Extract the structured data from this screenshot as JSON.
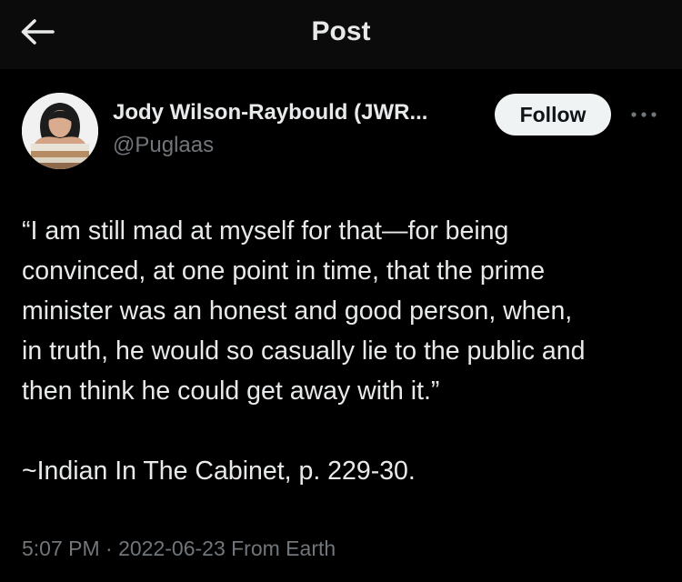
{
  "header": {
    "title": "Post",
    "back_icon": "arrow-left-icon"
  },
  "author": {
    "name": "Jody Wilson-Raybould (JWR...",
    "handle": "@Puglaas",
    "avatar": "profile-photo"
  },
  "actions": {
    "follow_label": "Follow",
    "more_icon": "more-horizontal-icon"
  },
  "tweet": {
    "lines": [
      "“I am still mad at myself for that—for being",
      "convinced, at one point in time, that the prime",
      "minister was an honest and good person, when,",
      "in truth, he would so casually lie to the public and",
      "then think he could get away with it.”",
      "",
      "~Indian In The Cabinet, p. 229-30."
    ]
  },
  "meta": {
    "text": "5:07 PM · 2022-06-23 From Earth"
  },
  "colors": {
    "background": "#000000",
    "header_background": "#0b0b0b",
    "text": "#e7e9ea",
    "secondary_text": "#71767b",
    "follow_button": "#eff3f4"
  }
}
